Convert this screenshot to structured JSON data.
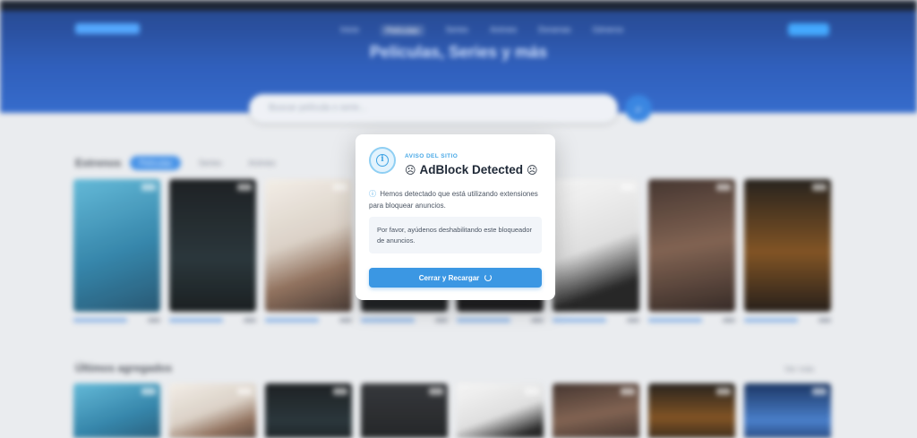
{
  "header": {
    "nav_items": [
      "Inicio",
      "Películas",
      "Series",
      "Animes",
      "Doramas",
      "Géneros"
    ],
    "hero_title": "Películas, Series y más",
    "search_placeholder": "Buscar película o serie..."
  },
  "sections": {
    "estrenos": {
      "title": "Estrenos",
      "tabs": [
        "Películas",
        "Series",
        "Animes"
      ]
    },
    "agregados": {
      "title": "Últimos agregados",
      "see_more": "Ver más"
    }
  },
  "modal": {
    "kicker": "AVISO DEL SITIO",
    "title": "AdBlock Detected",
    "sad_face": "☹",
    "info_mark": "i",
    "message_icon": "ⓘ",
    "message": "Hemos detectado que está utilizando extensiones para bloquear anuncios.",
    "note": "Por favor, ayúdenos deshabilitando este bloqueador de anuncios.",
    "button_label": "Cerrar y Recargar",
    "button_icon": "reload-icon"
  },
  "colors": {
    "accent": "#3b97e3",
    "kicker": "#48a8e6",
    "hero": "#2456b8"
  }
}
